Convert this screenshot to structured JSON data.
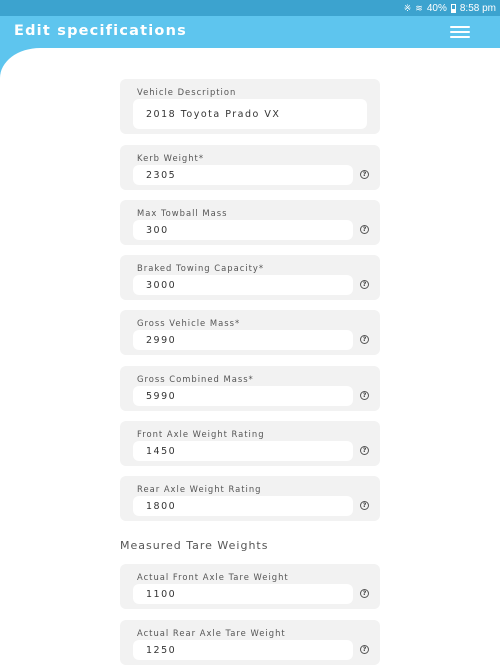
{
  "status_bar": {
    "bluetooth_icon": "bluetooth-icon",
    "wifi_icon": "wifi-icon",
    "battery_percent": "40%",
    "time": "8:58 pm"
  },
  "header": {
    "title": "Edit specifications",
    "menu_icon": "hamburger-menu-icon",
    "color": "#5ec5ee"
  },
  "help_symbol": "?",
  "fields": {
    "vehicle_description": {
      "label": "Vehicle Description",
      "value": "2018 Toyota Prado VX"
    },
    "kerb_weight": {
      "label": "Kerb Weight*",
      "value": "2305"
    },
    "max_towball_mass": {
      "label": "Max Towball Mass",
      "value": "300"
    },
    "braked_towing_capacity": {
      "label": "Braked Towing Capacity*",
      "value": "3000"
    },
    "gross_vehicle_mass": {
      "label": "Gross Vehicle Mass*",
      "value": "2990"
    },
    "gross_combined_mass": {
      "label": "Gross Combined Mass*",
      "value": "5990"
    },
    "front_axle_weight_rating": {
      "label": "Front Axle Weight Rating",
      "value": "1450"
    },
    "rear_axle_weight_rating": {
      "label": "Rear Axle Weight Rating",
      "value": "1800"
    }
  },
  "measured_section": {
    "title": "Measured Tare Weights",
    "actual_front_axle_tare_weight": {
      "label": "Actual Front Axle Tare Weight",
      "value": "1100"
    },
    "actual_rear_axle_tare_weight": {
      "label": "Actual Rear Axle Tare Weight",
      "value": "1250"
    }
  }
}
